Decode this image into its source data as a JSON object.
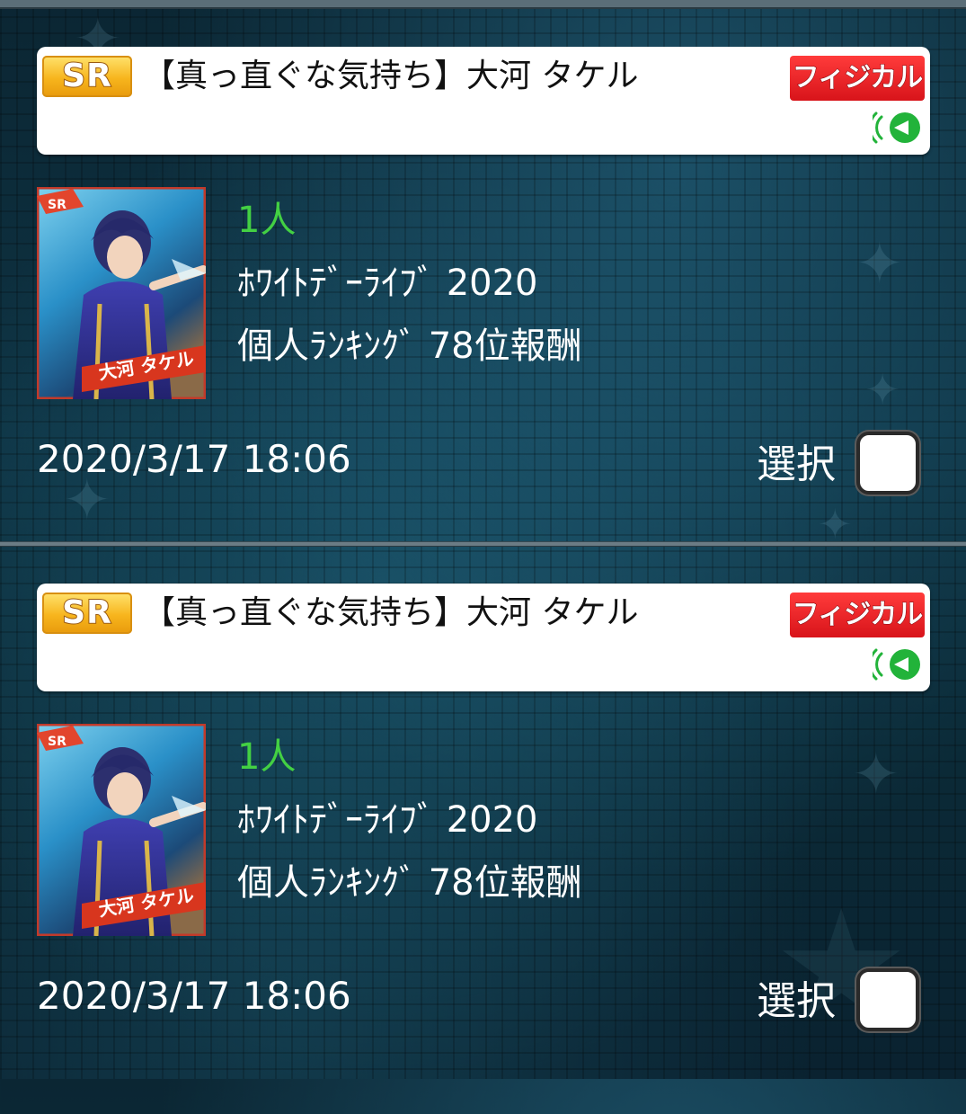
{
  "items": [
    {
      "rarity": "SR",
      "card_name": "【真っ直ぐな気持ち】大河 タケル",
      "type": "フィジカル",
      "quantity": "1人",
      "reward_event": "ﾎﾜｲﾄﾃﾞｰﾗｲﾌﾞ 2020",
      "reward_rank": "個人ﾗﾝｷﾝｸﾞ 78位報酬",
      "received_at": "2020/3/17 18:06",
      "select_label": "選択",
      "checked": false,
      "thumbnail_caption": "大河 タケル",
      "thumbnail_rarity": "SR"
    },
    {
      "rarity": "SR",
      "card_name": "【真っ直ぐな気持ち】大河 タケル",
      "type": "フィジカル",
      "quantity": "1人",
      "reward_event": "ﾎﾜｲﾄﾃﾞｰﾗｲﾌﾞ 2020",
      "reward_rank": "個人ﾗﾝｷﾝｸﾞ 78位報酬",
      "received_at": "2020/3/17 18:06",
      "select_label": "選択",
      "checked": false,
      "thumbnail_caption": "大河 タケル",
      "thumbnail_rarity": "SR"
    }
  ],
  "icons": {
    "type_voice": "voice-wave-icon"
  },
  "colors": {
    "quantity": "#43d043",
    "type_badge": "#d8141a",
    "rarity_badge": "#f7b51d"
  }
}
